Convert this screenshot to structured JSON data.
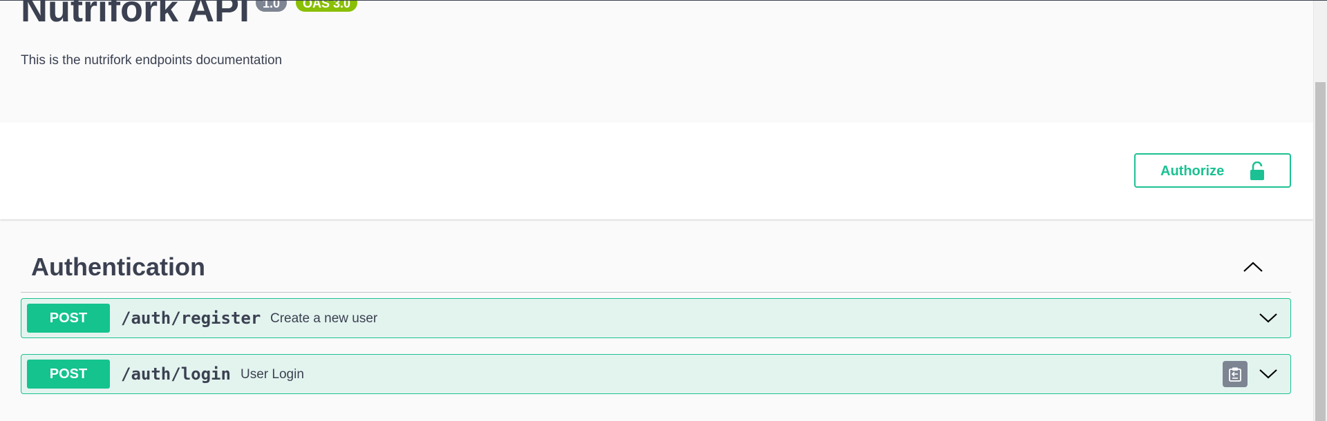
{
  "info": {
    "title": "Nutrifork API",
    "version_badge": "1.0",
    "oas_badge": "OAS 3.0",
    "description": "This is the nutrifork endpoints documentation"
  },
  "scheme_bar": {
    "authorize_label": "Authorize"
  },
  "tag": {
    "name": "Authentication",
    "expanded": true
  },
  "operations": [
    {
      "method": "POST",
      "path": "/auth/register",
      "summary": "Create a new user"
    },
    {
      "method": "POST",
      "path": "/auth/login",
      "summary": "User Login"
    }
  ],
  "icons": {
    "lock": "lock-icon",
    "collapse": "chevron-up-icon",
    "expand": "chevron-down-icon",
    "copy": "clipboard-icon"
  },
  "colors": {
    "text": "#3b4151",
    "post_green": "#14c38e",
    "post_bg": "#e3f4ef",
    "version_badge": "#7d8492",
    "oas_badge": "#89bf04",
    "authorize": "#1bc192"
  }
}
